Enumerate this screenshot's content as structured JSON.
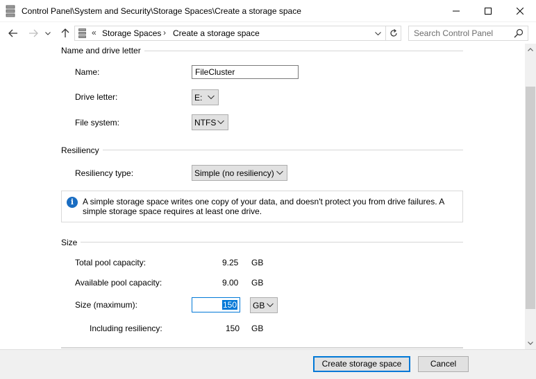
{
  "window": {
    "title": "Control Panel\\System and Security\\Storage Spaces\\Create a storage space"
  },
  "address": {
    "overflow": "«",
    "crumbs": [
      "Storage Spaces",
      "Create a storage space"
    ],
    "separator": "›"
  },
  "search": {
    "placeholder": "Search Control Panel"
  },
  "name_section": {
    "title": "Name and drive letter",
    "name_label": "Name:",
    "name_value": "FileCluster",
    "drive_label": "Drive letter:",
    "drive_value": "E:",
    "fs_label": "File system:",
    "fs_value": "NTFS"
  },
  "resiliency_section": {
    "title": "Resiliency",
    "type_label": "Resiliency type:",
    "type_value": "Simple (no resiliency)",
    "info_text": "A simple storage space writes one copy of your data, and doesn't protect you from drive failures. A simple storage space requires at least one drive."
  },
  "size_section": {
    "title": "Size",
    "total_label": "Total pool capacity:",
    "total_value": "9.25",
    "total_unit": "GB",
    "available_label": "Available pool capacity:",
    "available_value": "9.00",
    "available_unit": "GB",
    "size_label": "Size (maximum):",
    "size_value": "150",
    "size_unit": "GB",
    "including_label": "Including resiliency:",
    "including_value": "150",
    "including_unit": "GB"
  },
  "footer": {
    "create_label": "Create storage space",
    "cancel_label": "Cancel"
  },
  "colors": {
    "accent": "#0078d7",
    "info": "#1a6dc2"
  }
}
